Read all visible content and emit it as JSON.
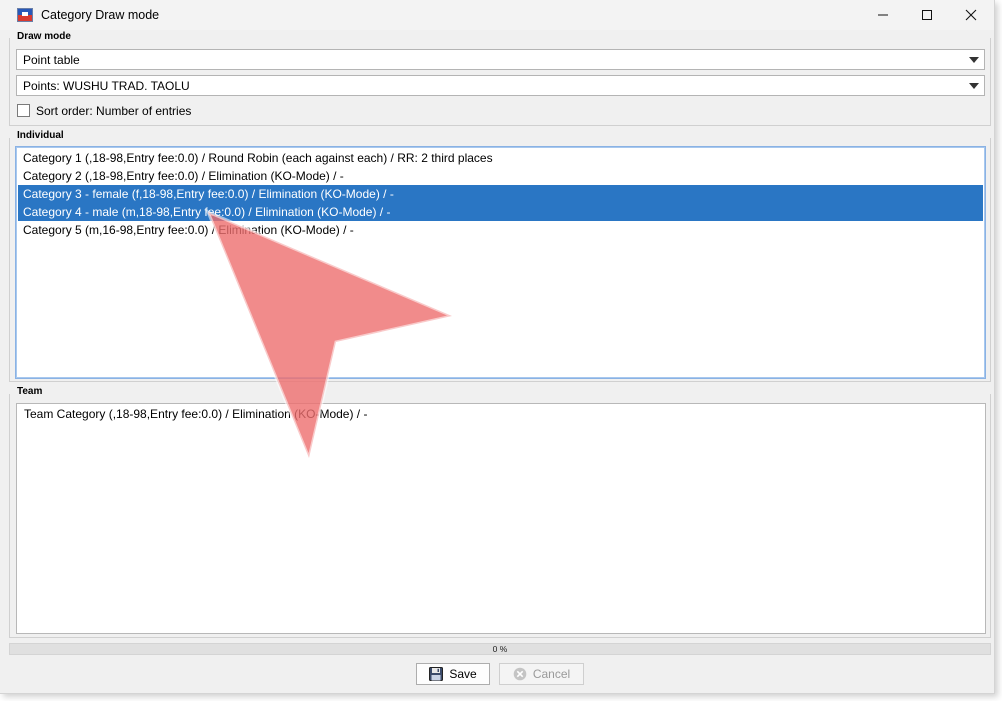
{
  "window": {
    "title": "Category Draw mode"
  },
  "draw_mode": {
    "group_label": "Draw mode",
    "mode_select": "Point table",
    "points_select": "Points: WUSHU TRAD. TAOLU",
    "sort_checkbox": {
      "label": "Sort order: Number of entries",
      "checked": false
    }
  },
  "individual": {
    "group_label": "Individual",
    "items": [
      {
        "label": "Category 1 (,18-98,Entry fee:0.0) / Round Robin (each against each) / RR: 2 third places",
        "selected": false
      },
      {
        "label": "Category 2 (,18-98,Entry fee:0.0) / Elimination (KO-Mode) / -",
        "selected": false
      },
      {
        "label": "Category 3 - female (f,18-98,Entry fee:0.0) / Elimination (KO-Mode) / -",
        "selected": true
      },
      {
        "label": "Category 4 - male (m,18-98,Entry fee:0.0) / Elimination (KO-Mode) / -",
        "selected": true
      },
      {
        "label": "Category 5 (m,16-98,Entry fee:0.0) / Elimination (KO-Mode) / -",
        "selected": false
      }
    ]
  },
  "team": {
    "group_label": "Team",
    "items": [
      {
        "label": "Team Category (,18-98,Entry fee:0.0) / Elimination (KO-Mode) / -",
        "selected": false
      }
    ]
  },
  "progress": {
    "value": 0,
    "text": "0 %"
  },
  "buttons": {
    "save_label": "Save",
    "cancel_label": "Cancel",
    "cancel_enabled": false
  },
  "colors": {
    "selection": "#2a76c4",
    "cursor_overlay": "#ee6e6e"
  },
  "icons": {
    "app": "flag-icon",
    "save": "floppy-disk-icon",
    "cancel": "cancel-circle-icon"
  }
}
